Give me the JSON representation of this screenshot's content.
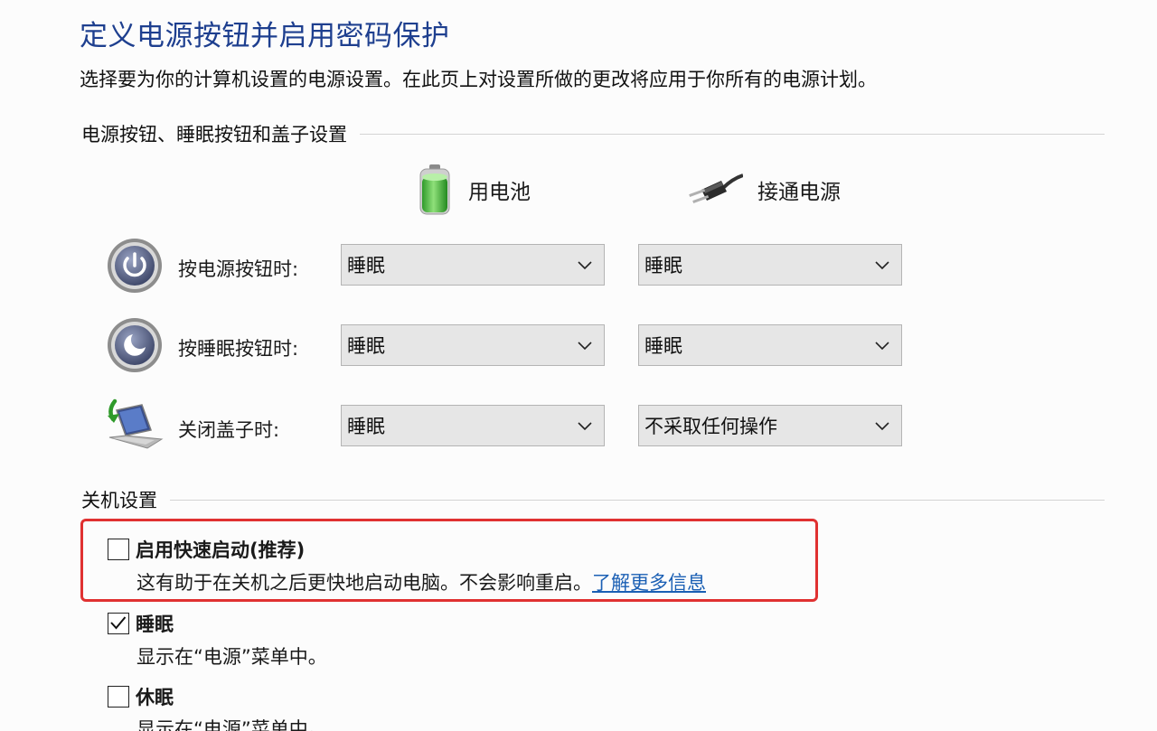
{
  "page": {
    "title": "定义电源按钮并启用密码保护",
    "description": "选择要为你的计算机设置的电源设置。在此页上对设置所做的更改将应用于你所有的电源计划。"
  },
  "power_buttons_section": {
    "title": "电源按钮、睡眠按钮和盖子设置",
    "columns": {
      "battery": {
        "label": "用电池",
        "icon": "battery-icon"
      },
      "plugged_in": {
        "label": "接通电源",
        "icon": "power-plug-icon"
      }
    },
    "rows": [
      {
        "label": "按电源按钮时:",
        "icon": "power-button-icon",
        "battery": "睡眠",
        "plugged_in": "睡眠"
      },
      {
        "label": "按睡眠按钮时:",
        "icon": "sleep-button-icon",
        "battery": "睡眠",
        "plugged_in": "睡眠"
      },
      {
        "label": "关闭盖子时:",
        "icon": "laptop-lid-icon",
        "battery": "睡眠",
        "plugged_in": "不采取任何操作"
      }
    ]
  },
  "shutdown_section": {
    "title": "关机设置",
    "options": [
      {
        "title": "启用快速启动(推荐)",
        "checked": false,
        "desc": "这有助于在关机之后更快地启动电脑。不会影响重启。",
        "link": "了解更多信息",
        "highlight_color": "#e03131"
      },
      {
        "title": "睡眠",
        "checked": true,
        "desc": "显示在“电源”菜单中。"
      },
      {
        "title": "休眠",
        "checked": false,
        "desc": "显示在“电源”菜单中。"
      }
    ]
  },
  "colors": {
    "title": "#1e3f8f",
    "link": "#1a5fb4",
    "highlight": "#e03131"
  }
}
